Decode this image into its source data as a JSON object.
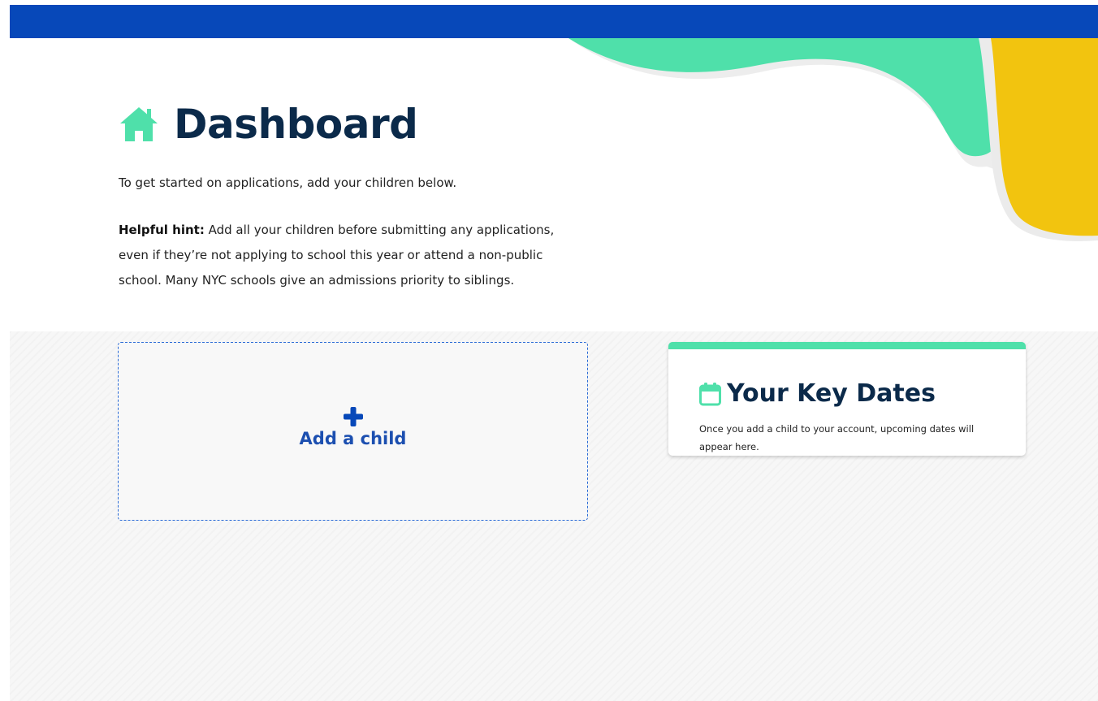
{
  "header": {
    "title": "Dashboard",
    "icon": "home-icon"
  },
  "intro": {
    "text": "To get started on applications, add your children below."
  },
  "hint": {
    "label": "Helpful hint:",
    "text": " Add all your children before submitting any applications, even if they’re not applying to school this year or attend a non-public school. Many NYC schools give an admissions priority to siblings."
  },
  "add_child": {
    "label": "Add a child",
    "icon": "plus-icon"
  },
  "key_dates": {
    "title": "Your Key Dates",
    "icon": "calendar-icon",
    "description": "Once you add a child to your account, upcoming dates will appear here."
  },
  "colors": {
    "top_bar": "#0748b9",
    "accent_green": "#4fe0aa",
    "accent_yellow": "#f2c40f",
    "title_navy": "#0b2a4a",
    "link_blue": "#1c4fb0"
  }
}
